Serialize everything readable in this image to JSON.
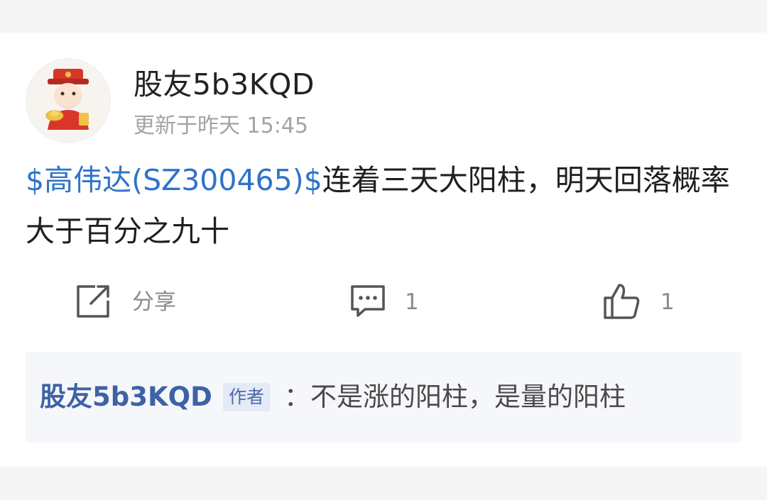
{
  "post": {
    "author": "股友5b3KQD",
    "timestamp": "更新于昨天 15:45",
    "stock_link": "$高伟达(SZ300465)$",
    "body_text": "连着三天大阳柱，明天回落概率大于百分之九十"
  },
  "actions": {
    "share_label": "分享",
    "comment_count": "1",
    "like_count": "1"
  },
  "comment": {
    "author": "股友5b3KQD",
    "badge": "作者",
    "text": "：不是涨的阳柱，是量的阳柱"
  },
  "colors": {
    "link": "#2f73c9",
    "comment_author": "#3e62a4"
  }
}
